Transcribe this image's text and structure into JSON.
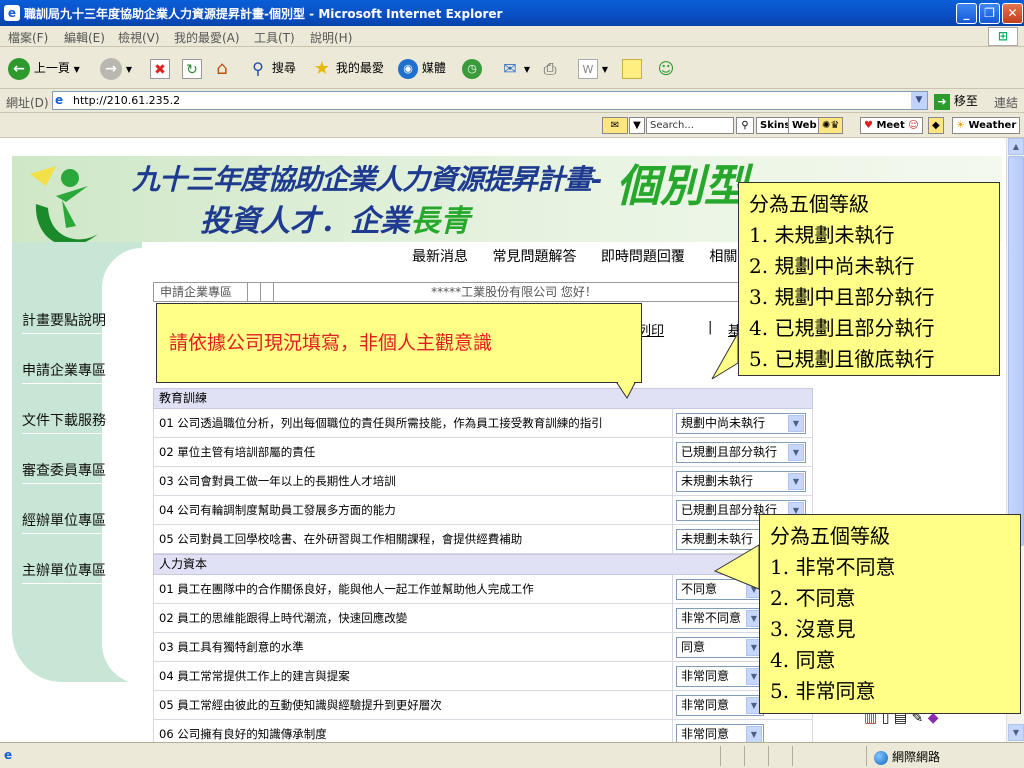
{
  "window": {
    "title": "職訓局九十三年度協助企業人力資源提昇計畫-個別型 - Microsoft Internet Explorer",
    "min": "_",
    "max": "❐",
    "close": "✕"
  },
  "menu": [
    "檔案(F)",
    "編輯(E)",
    "檢視(V)",
    "我的最愛(A)",
    "工具(T)",
    "說明(H)"
  ],
  "toolbar": {
    "back": "上一頁",
    "search": "搜尋",
    "favorites": "我的最愛",
    "media": "媒體"
  },
  "address": {
    "label": "網址(D)",
    "url": "http://210.61.235.2",
    "go": "移至",
    "links": "連結"
  },
  "linksbar": {
    "search_placeholder": "Search...",
    "skins": "Skins",
    "web": "Web",
    "meet": "Meet",
    "weather": "Weather"
  },
  "banner": {
    "title_main": "九十三年度協助企業人力資源提昇計畫-",
    "title_type": "個別型",
    "slogan_blue": "投資人才．企業",
    "slogan_green": "長青"
  },
  "topnav": [
    "最新消息",
    "常見問題解答",
    "即時問題回覆",
    "相關"
  ],
  "sidebar": [
    "計畫要點說明",
    "申請企業專區",
    "文件下載服務",
    "審查委員專區",
    "經辦單位專區",
    "主辦單位專區"
  ],
  "header_strip": {
    "area": "申請企業專區",
    "greeting": "*****工業股份有限公司 您好！"
  },
  "print_link": "請表列印",
  "print_sep": "|",
  "print_link2": "基",
  "sections": [
    {
      "title": "教育訓練",
      "rows": [
        {
          "q": "01 公司透過職位分析，列出每個職位的責任與所需技能，作為員工接受教育訓練的指引",
          "a": "規劃中尚未執行"
        },
        {
          "q": "02 單位主管有培訓部屬的責任",
          "a": "已規劃且部分執行"
        },
        {
          "q": "03 公司會對員工做一年以上的長期性人才培訓",
          "a": "未規劃未執行"
        },
        {
          "q": "04 公司有輪調制度幫助員工發展多方面的能力",
          "a": "已規劃且部分執行"
        },
        {
          "q": "05 公司對員工回學校唸書、在外研習與工作相關課程，會提供經費補助",
          "a": "未規劃未執行"
        }
      ]
    },
    {
      "title": "人力資本",
      "rows": [
        {
          "q": "01 員工在團隊中的合作關係良好，能與他人一起工作並幫助他人完成工作",
          "a": "不同意"
        },
        {
          "q": "02 員工的思維能跟得上時代潮流，快速回應改變",
          "a": "非常不同意"
        },
        {
          "q": "03 員工具有獨特創意的水準",
          "a": "同意"
        },
        {
          "q": "04 員工常常提供工作上的建言與提案",
          "a": "非常同意"
        },
        {
          "q": "05 員工常經由彼此的互動使知識與經驗提升到更好層次",
          "a": "非常同意"
        },
        {
          "q": "06 公司擁有良好的知識傳承制度",
          "a": "非常同意"
        }
      ]
    }
  ],
  "callouts": {
    "note": "請依據公司現況填寫，非個人主觀意識",
    "scale1": [
      "分為五個等級",
      "1. 未規劃未執行",
      "2. 規劃中尚未執行",
      "3. 規劃中且部分執行",
      "4. 已規劃且部分執行",
      "5. 已規劃且徹底執行"
    ],
    "scale2": [
      "分為五個等級",
      "1. 非常不同意",
      "2. 不同意",
      "3. 沒意見",
      "4. 同意",
      "5. 非常同意"
    ]
  },
  "status": {
    "zone": "網際網路"
  }
}
